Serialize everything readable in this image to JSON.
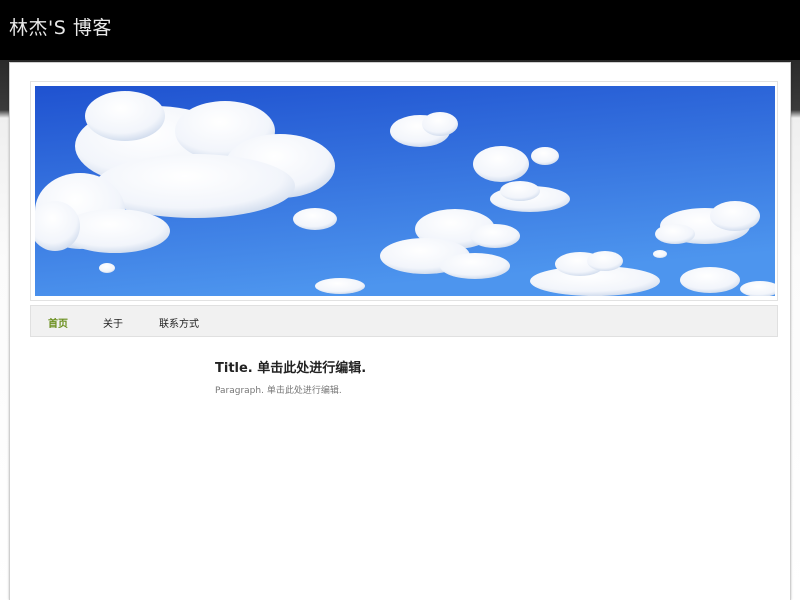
{
  "site": {
    "title": "林杰'S 博客"
  },
  "colors": {
    "topbar": "#000000",
    "nav_active": "#6a8f1e",
    "sky_top": "#1f52d0",
    "sky_bottom": "#4d95ee"
  },
  "nav": {
    "items": [
      {
        "label": "首页",
        "active": true
      },
      {
        "label": "关于",
        "active": false
      },
      {
        "label": "联系方式",
        "active": false
      }
    ]
  },
  "content": {
    "title": "Title. 单击此处进行编辑.",
    "paragraph": "Paragraph. 单击此处进行编辑."
  },
  "header": {
    "image": "sky-clouds-banner"
  }
}
